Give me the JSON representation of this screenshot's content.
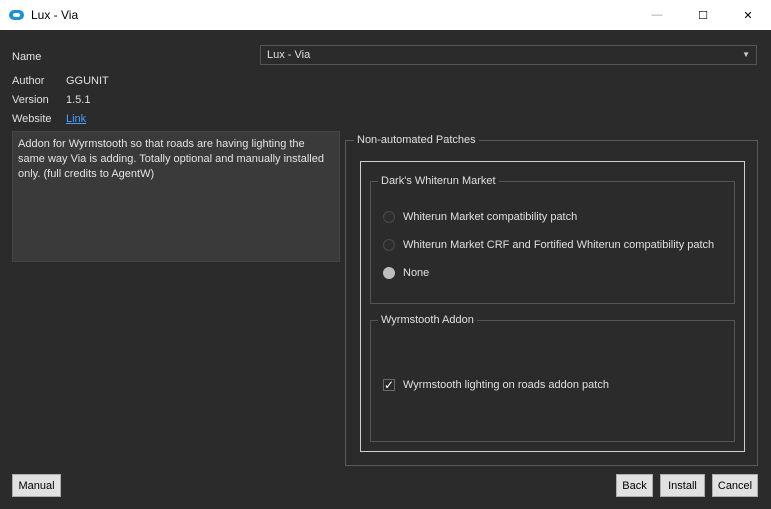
{
  "window": {
    "title": "Lux - Via",
    "controls": {
      "minimize": "—",
      "maximize": "☐",
      "close": "✕"
    }
  },
  "info": {
    "name_label": "Name",
    "name_value": "Lux - Via",
    "author_label": "Author",
    "author_value": "GGUNIT",
    "version_label": "Version",
    "version_value": "1.5.1",
    "website_label": "Website",
    "website_link": "Link"
  },
  "description": "Addon for Wyrmstooth so that roads are having lighting the same way Via is adding. Totally optional and manually installed only. (full credits to AgentW)",
  "patches": {
    "title": "Non-automated Patches",
    "groups": [
      {
        "title": "Dark's Whiterun Market",
        "options": [
          {
            "label": "Whiterun Market compatibility patch",
            "checked": false
          },
          {
            "label": "Whiterun Market CRF and Fortified Whiterun compatibility patch",
            "checked": false
          },
          {
            "label": "None",
            "checked": true
          }
        ]
      },
      {
        "title": "Wyrmstooth Addon",
        "options": [
          {
            "label": "Wyrmstooth lighting on roads addon patch",
            "checked": true
          }
        ]
      }
    ]
  },
  "buttons": {
    "manual": "Manual",
    "back": "Back",
    "install": "Install",
    "cancel": "Cancel"
  },
  "colors": {
    "background": "#2b2b2b",
    "link": "#4a9eff",
    "titlebar": "#ffffff"
  }
}
